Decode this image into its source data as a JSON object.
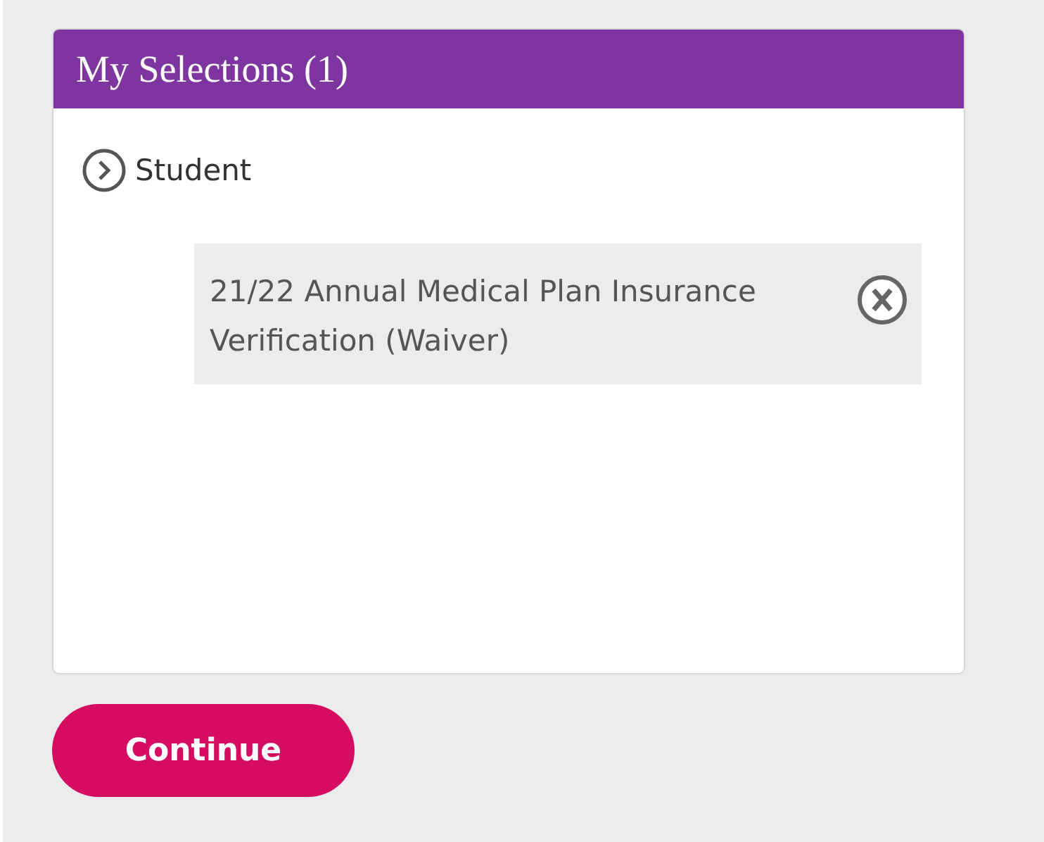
{
  "panel": {
    "title": "My Selections (1)"
  },
  "groups": [
    {
      "label": "Student",
      "items": [
        {
          "label": "21/22 Annual Medical Plan Insurance Verification (Waiver)"
        }
      ]
    }
  ],
  "buttons": [
    "Continue"
  ]
}
